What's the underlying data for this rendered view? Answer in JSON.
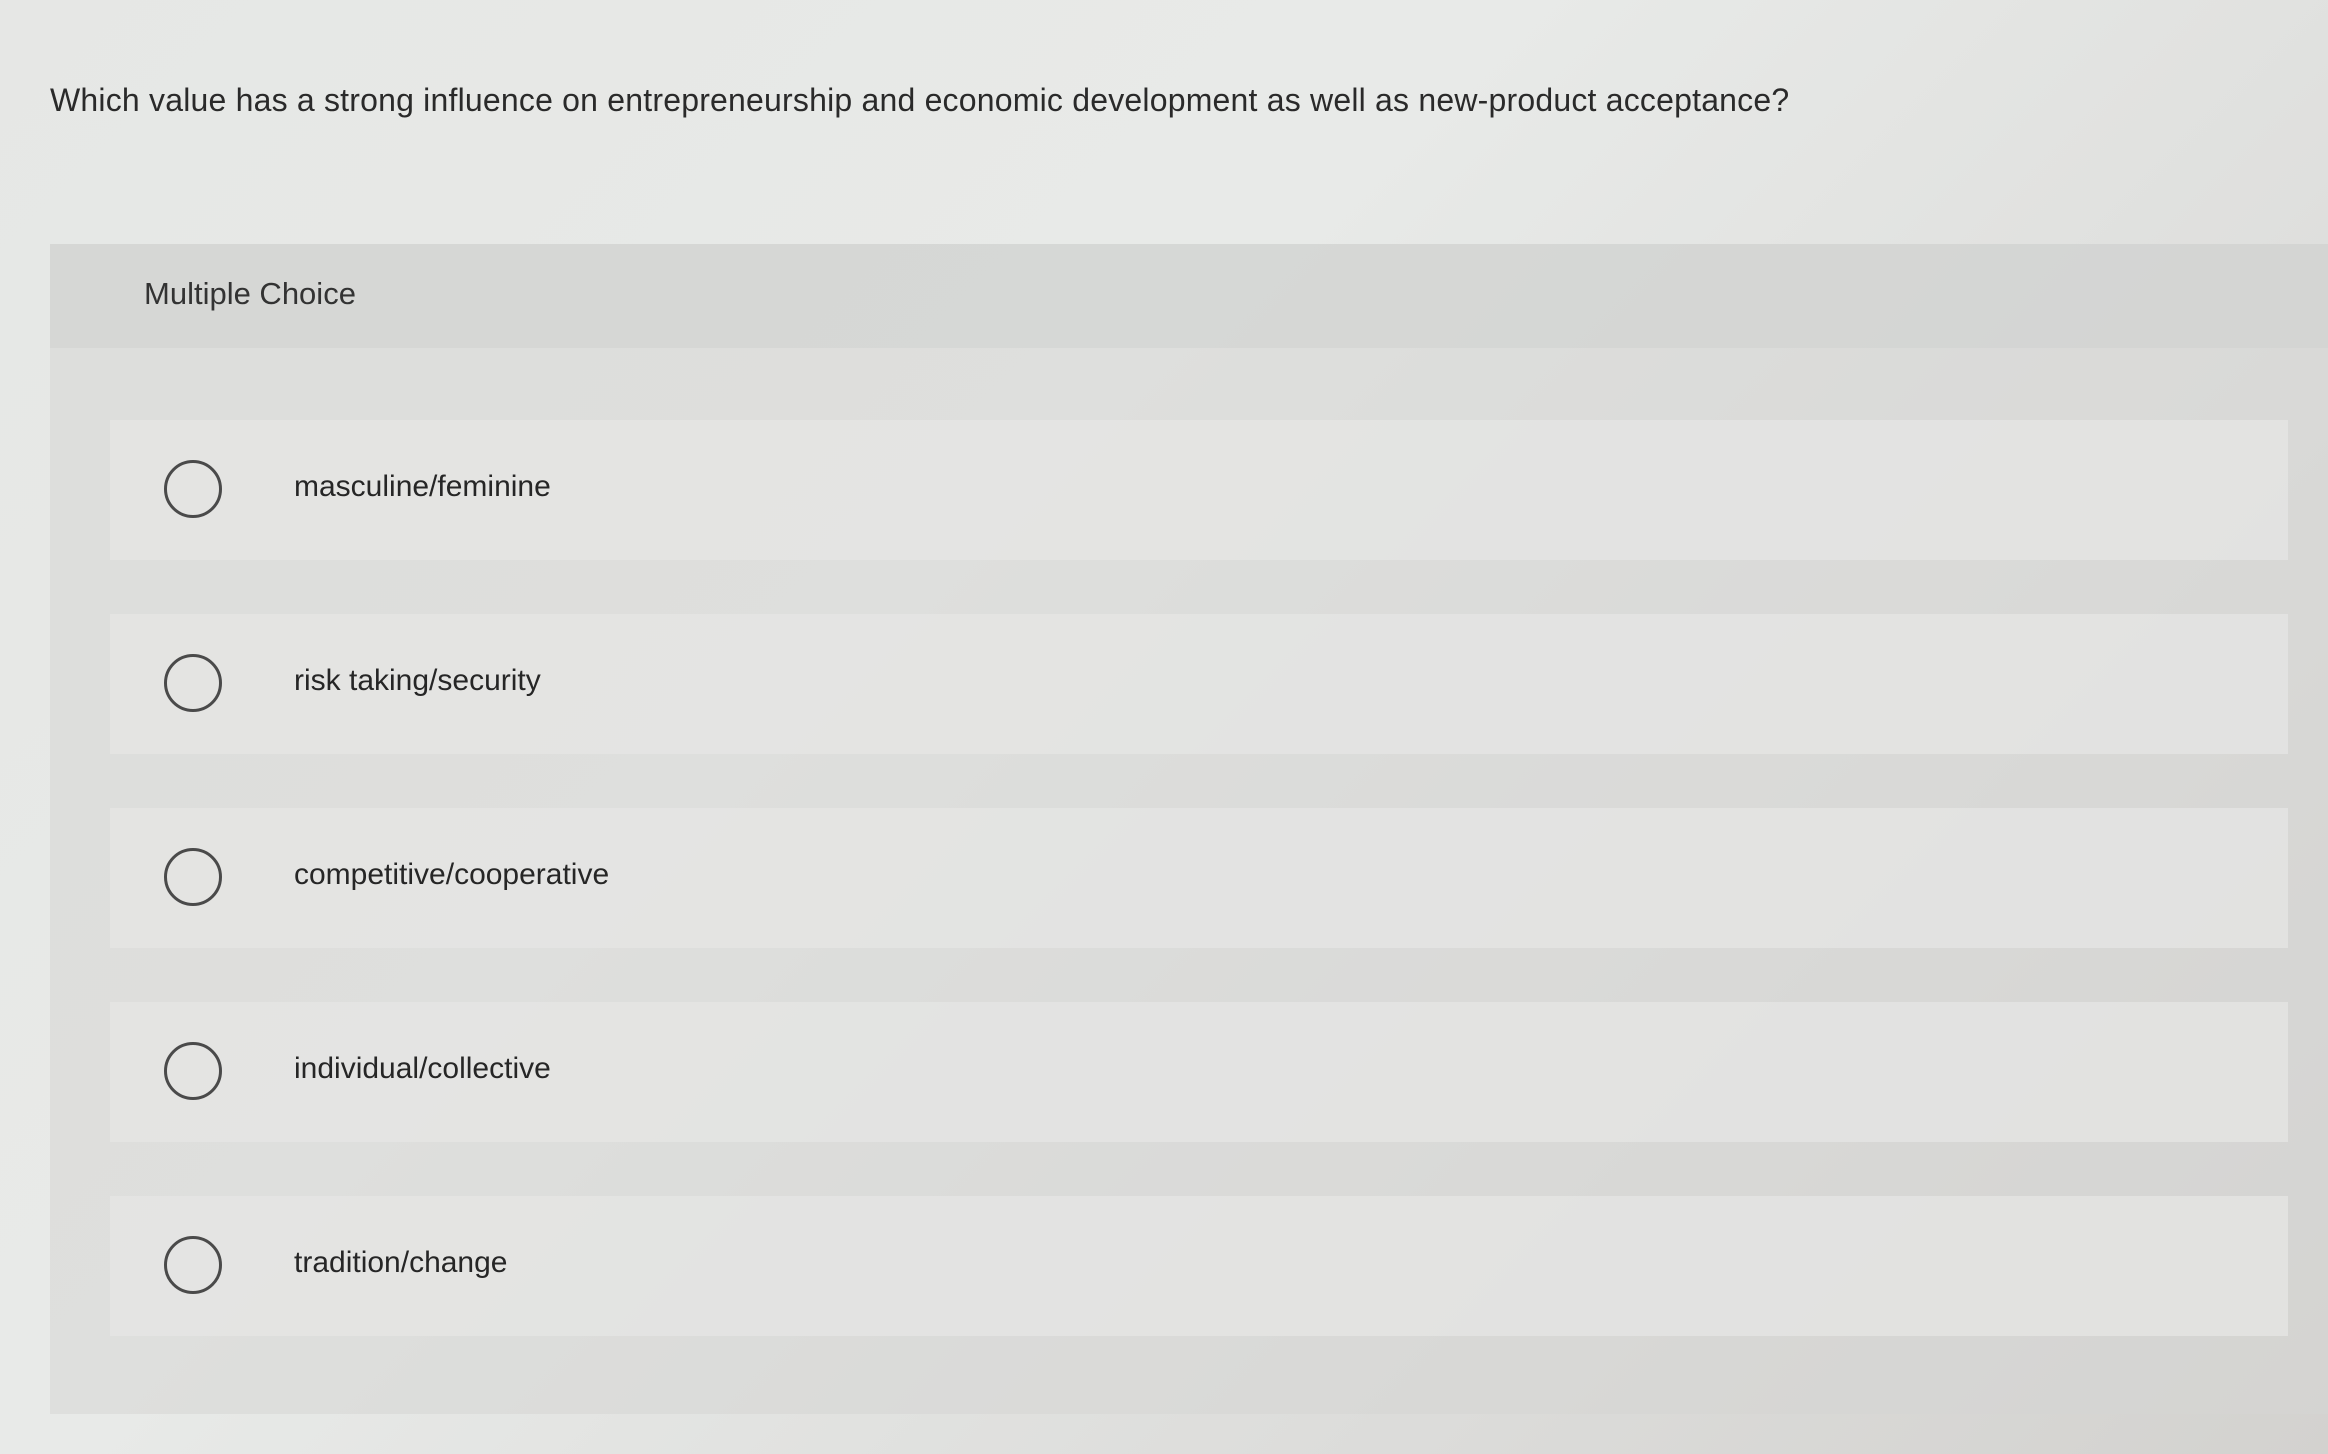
{
  "question": {
    "text": "Which value has a strong influence on entrepreneurship and economic development as well as new-product acceptance?"
  },
  "panel": {
    "header_label": "Multiple Choice",
    "options": [
      {
        "label": "masculine/feminine",
        "selected": false
      },
      {
        "label": "risk taking/security",
        "selected": false
      },
      {
        "label": "competitive/cooperative",
        "selected": false
      },
      {
        "label": "individual/collective",
        "selected": false
      },
      {
        "label": "tradition/change",
        "selected": false
      }
    ]
  }
}
